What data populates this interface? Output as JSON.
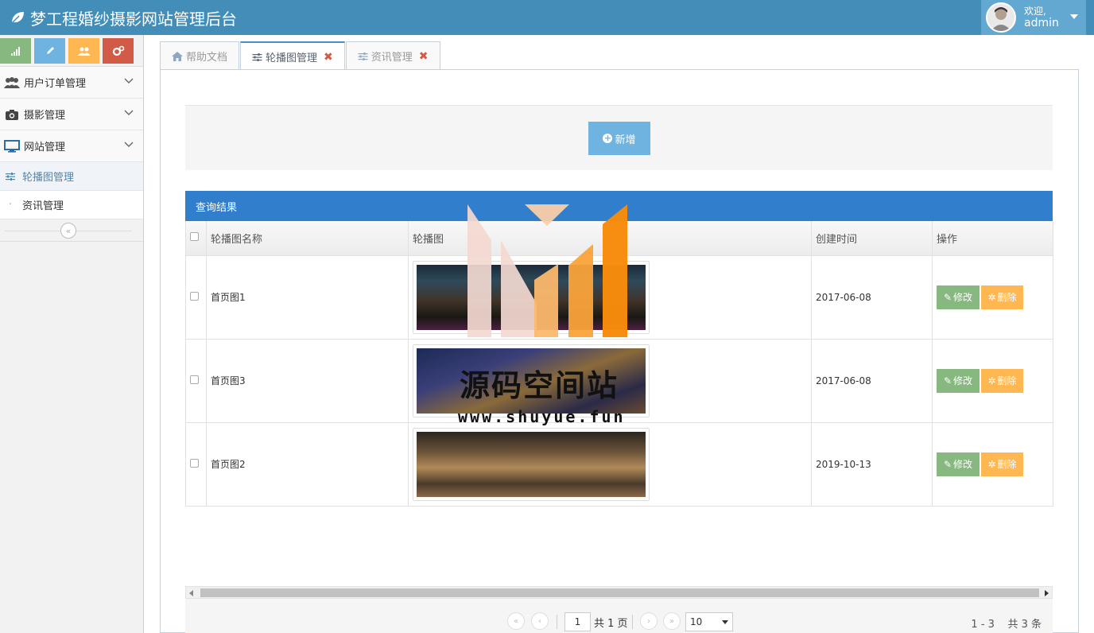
{
  "header": {
    "title": "梦工程婚纱摄影网站管理后台",
    "welcome": "欢迎,",
    "username": "admin"
  },
  "sidebar": {
    "menu": [
      {
        "label": "用户订单管理",
        "icon": "users-icon"
      },
      {
        "label": "摄影管理",
        "icon": "camera-icon"
      },
      {
        "label": "网站管理",
        "icon": "desktop-icon"
      }
    ],
    "submenu": [
      {
        "label": "轮播图管理",
        "active": true
      },
      {
        "label": "资讯管理",
        "active": false
      }
    ]
  },
  "tabs": [
    {
      "label": "帮助文档",
      "closable": false
    },
    {
      "label": "轮播图管理",
      "closable": true,
      "active": true
    },
    {
      "label": "资讯管理",
      "closable": true
    }
  ],
  "toolbar": {
    "add_label": "新增"
  },
  "results": {
    "title": "查询结果",
    "columns": [
      "轮播图名称",
      "轮播图",
      "创建时间",
      "操作"
    ],
    "rows": [
      {
        "name": "首页图1",
        "date": "2017-06-08"
      },
      {
        "name": "首页图3",
        "date": "2017-06-08"
      },
      {
        "name": "首页图2",
        "date": "2019-10-13"
      }
    ],
    "edit_label": "修改",
    "delete_label": "删除"
  },
  "pager": {
    "page": "1",
    "total_pages": "共 1 页",
    "page_size": "10",
    "info": "1 - 3    共 3 条"
  },
  "watermark": {
    "text": "源码空间站",
    "url": "www.shuyue.fun"
  },
  "colors": {
    "header": "#438eb9",
    "result_header": "#307ecc",
    "edit": "#87b87f",
    "delete": "#ffb752",
    "add": "#6fb3e0"
  }
}
